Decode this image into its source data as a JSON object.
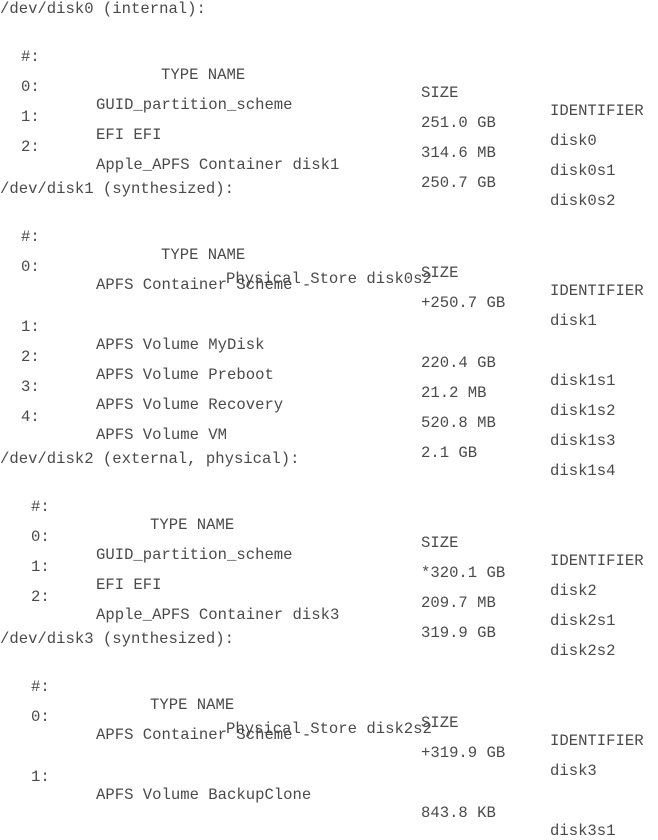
{
  "disks": [
    {
      "header": "/dev/disk0 (internal):",
      "columns": {
        "num": "#:",
        "type_name": "TYPE NAME",
        "size": "SIZE",
        "identifier": "IDENTIFIER"
      },
      "rows": [
        {
          "num": "0:",
          "type_name": "GUID_partition_scheme",
          "size": "251.0 GB",
          "identifier": "disk0"
        },
        {
          "num": "1:",
          "type_name": "EFI EFI",
          "size": "314.6 MB",
          "identifier": "disk0s1"
        },
        {
          "num": "2:",
          "type_name": "Apple_APFS Container disk1",
          "size": "250.7 GB",
          "identifier": "disk0s2"
        }
      ]
    },
    {
      "header": "/dev/disk1 (synthesized):",
      "columns": {
        "num": "#:",
        "type_name": "TYPE NAME",
        "size": "SIZE",
        "identifier": "IDENTIFIER"
      },
      "rows": [
        {
          "num": "0:",
          "type_name": "APFS Container Scheme -",
          "size": "+250.7 GB",
          "identifier": "disk1"
        },
        {
          "continuation": "Physical Store disk0s2"
        },
        {
          "num": "1:",
          "type_name": "APFS Volume MyDisk",
          "size": "220.4 GB",
          "identifier": "disk1s1"
        },
        {
          "num": "2:",
          "type_name": "APFS Volume Preboot",
          "size": "21.2 MB",
          "identifier": "disk1s2"
        },
        {
          "num": "3:",
          "type_name": "APFS Volume Recovery",
          "size": "520.8 MB",
          "identifier": "disk1s3"
        },
        {
          "num": "4:",
          "type_name": "APFS Volume VM",
          "size": "2.1 GB",
          "identifier": "disk1s4"
        }
      ]
    },
    {
      "header": "/dev/disk2 (external, physical):",
      "columns": {
        "num": "#:",
        "type_name": "TYPE NAME",
        "size": "SIZE",
        "identifier": "IDENTIFIER"
      },
      "rows": [
        {
          "num": "0:",
          "type_name": "GUID_partition_scheme",
          "size": "*320.1 GB",
          "identifier": "disk2"
        },
        {
          "num": "1:",
          "type_name": "EFI EFI",
          "size": "209.7 MB",
          "identifier": "disk2s1"
        },
        {
          "num": "2:",
          "type_name": "Apple_APFS Container disk3",
          "size": "319.9 GB",
          "identifier": "disk2s2"
        }
      ]
    },
    {
      "header": "/dev/disk3 (synthesized):",
      "columns": {
        "num": "#:",
        "type_name": "TYPE NAME",
        "size": "SIZE",
        "identifier": "IDENTIFIER"
      },
      "rows": [
        {
          "num": "0:",
          "type_name": "APFS Container Scheme -",
          "size": "+319.9 GB",
          "identifier": "disk3"
        },
        {
          "continuation": "Physical Store disk2s2"
        },
        {
          "num": "1:",
          "type_name": "APFS Volume BackupClone",
          "size": "843.8 KB",
          "identifier": "disk3s1"
        }
      ]
    }
  ]
}
